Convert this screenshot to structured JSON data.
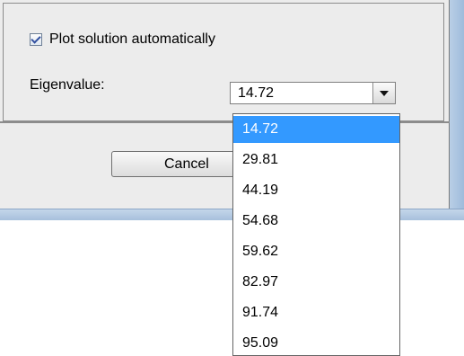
{
  "checkbox": {
    "label": "Plot solution automatically",
    "checked": true
  },
  "eigenvalue": {
    "label": "Eigenvalue:",
    "selected_value": "14.72",
    "options": [
      "14.72",
      "29.81",
      "44.19",
      "54.68",
      "59.62",
      "82.97",
      "91.74",
      "95.09"
    ]
  },
  "buttons": {
    "cancel_label": "Cancel"
  },
  "colors": {
    "selection": "#3399ff",
    "window_background": "#ececec",
    "frame_blue": "#a7c0dc"
  }
}
